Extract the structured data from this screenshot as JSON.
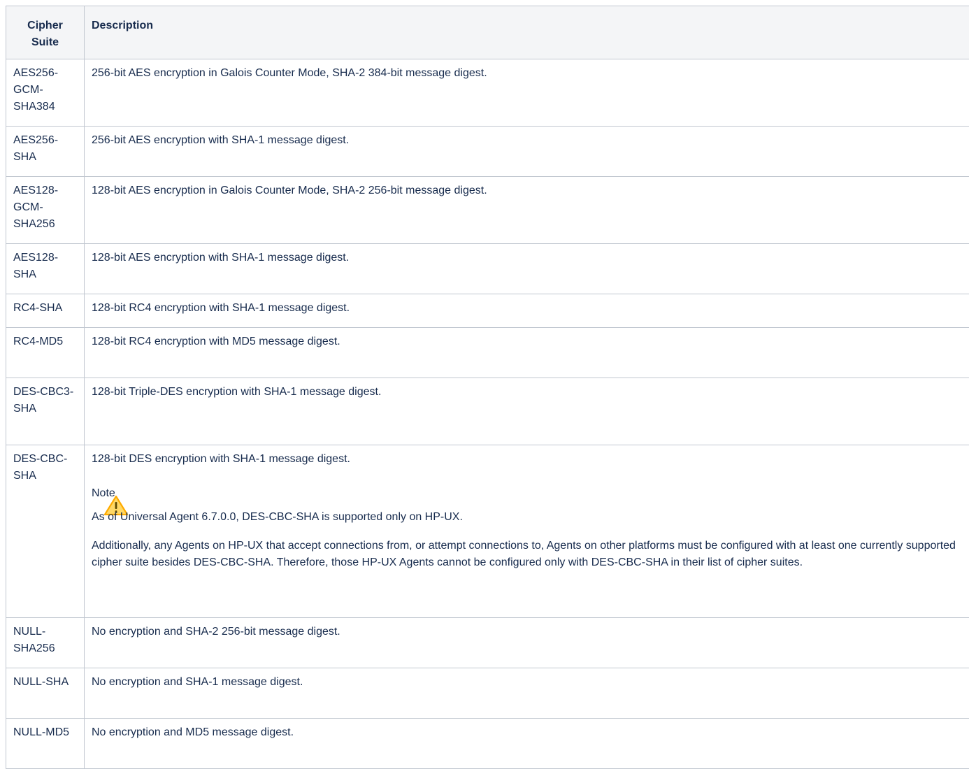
{
  "table": {
    "headers": {
      "suite": "Cipher Suite",
      "description": "Description"
    },
    "rows": [
      {
        "suite": "AES256-GCM-SHA384",
        "description": "256-bit AES encryption in Galois Counter Mode, SHA-2 384-bit message digest."
      },
      {
        "suite": "AES256-SHA",
        "description": "256-bit AES encryption with SHA-1 message digest."
      },
      {
        "suite": "AES128-GCM-SHA256",
        "description": "128-bit AES encryption in Galois Counter Mode, SHA-2 256-bit message digest."
      },
      {
        "suite": "AES128-SHA",
        "description": "128-bit AES encryption with SHA-1 message digest."
      },
      {
        "suite": "RC4-SHA",
        "description": "128-bit RC4 encryption with SHA-1 message digest."
      },
      {
        "suite": "RC4-MD5",
        "description": "128-bit RC4 encryption with MD5 message digest."
      },
      {
        "suite": "DES-CBC3-SHA",
        "description": "128-bit Triple-DES encryption with SHA-1 message digest."
      },
      {
        "suite": "DES-CBC-SHA",
        "description": "128-bit DES encryption with SHA-1 message digest.",
        "note": {
          "title": "Note",
          "icon": "warning-icon",
          "line1": "As of Universal Agent 6.7.0.0, DES-CBC-SHA is supported only on HP-UX.",
          "paragraph": "Additionally, any Agents on HP-UX that accept connections from, or attempt connections to, Agents on other platforms must be configured with at least one currently supported cipher suite besides DES-CBC-SHA. Therefore, those HP-UX Agents cannot be configured only with DES-CBC-SHA in their list of cipher suites."
        }
      },
      {
        "suite": "NULL-SHA256",
        "description": "No encryption and SHA-2 256-bit message digest."
      },
      {
        "suite": "NULL-SHA",
        "description": "No encryption and SHA-1 message digest."
      },
      {
        "suite": "NULL-MD5",
        "description": "No encryption and MD5 message digest."
      }
    ]
  },
  "colors": {
    "border": "#c1c7d0",
    "header_bg": "#f4f5f7",
    "text": "#172b4d",
    "warning": "#ffab00"
  }
}
